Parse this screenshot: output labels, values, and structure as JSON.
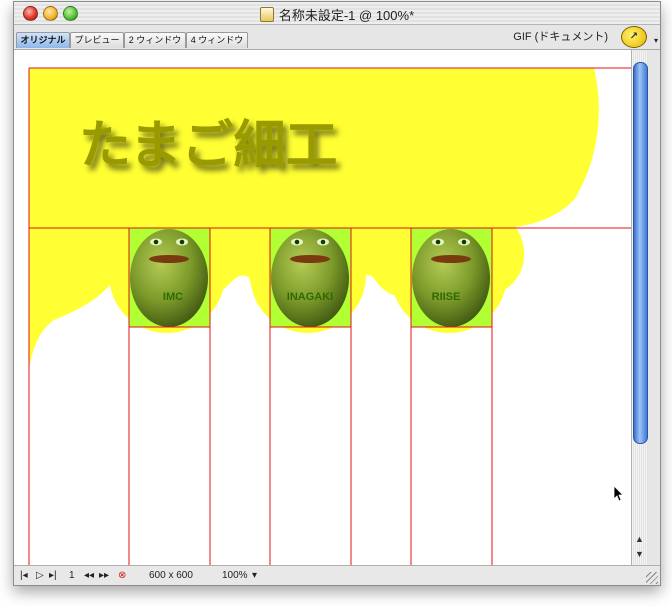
{
  "window": {
    "title": "名称未設定-1 @ 100%*"
  },
  "tabs": [
    {
      "label": "オリジナル",
      "active": true
    },
    {
      "label": "プレビュー",
      "active": false
    },
    {
      "label": "2 ウィンドウ",
      "active": false
    },
    {
      "label": "4 ウィンドウ",
      "active": false
    }
  ],
  "optimize": {
    "format_label": "GIF (ドキュメント)"
  },
  "canvas": {
    "heading": "たまご細工",
    "eggs": [
      {
        "label": "IMC"
      },
      {
        "label": "INAGAKI"
      },
      {
        "label": "RIISE"
      }
    ],
    "colors": {
      "background_shape": "#ffff33",
      "slice_fill": "#b2ff33",
      "egg": "#7c9a2a",
      "slice_lines": "#e0101a"
    }
  },
  "status": {
    "frame": "1",
    "dimensions": "600 x 600",
    "zoom": "100%"
  },
  "icons": [
    "close-icon",
    "minimize-icon",
    "zoom-icon",
    "document-icon",
    "jump-to-imageready-icon",
    "first-frame-icon",
    "play-icon",
    "next-frame-icon",
    "prev-frame-icon",
    "last-frame-icon",
    "stop-icon",
    "chevron-down-icon",
    "scroll-up-icon",
    "scroll-down-icon",
    "resize-grip-icon",
    "mouse-pointer-icon"
  ]
}
